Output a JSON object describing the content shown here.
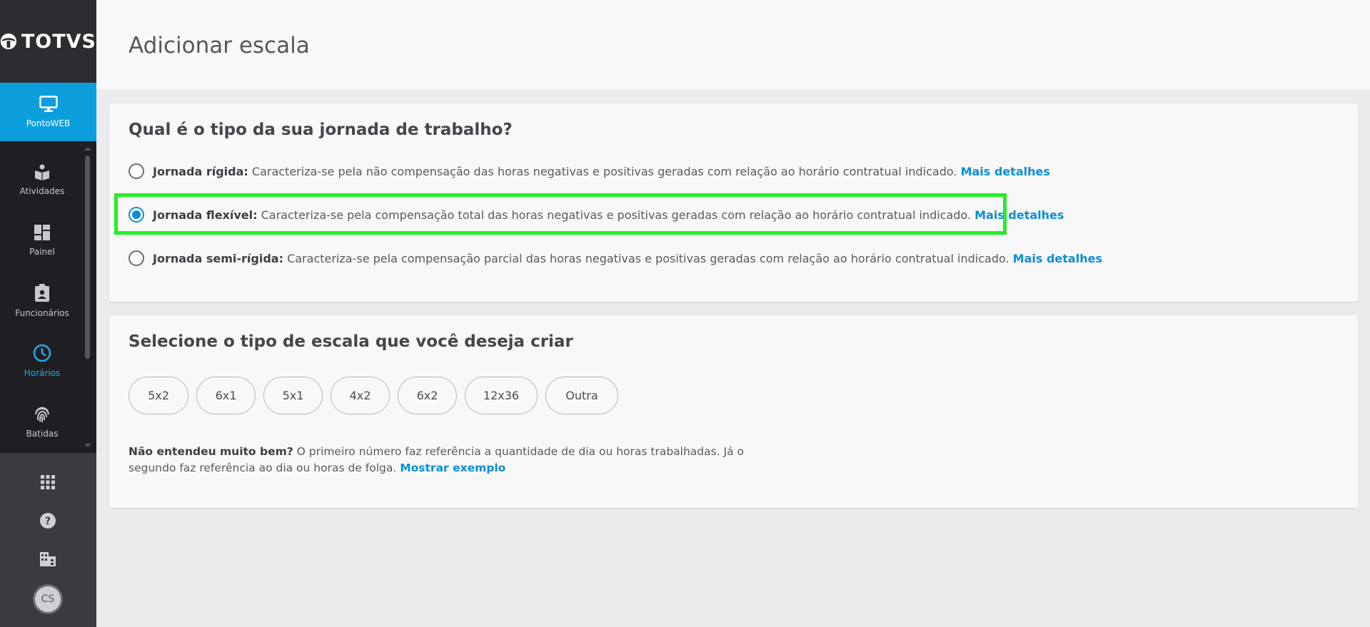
{
  "brand": {
    "logo_text": "TOTVS"
  },
  "sidebar": {
    "active_module": {
      "label": "PontoWEB",
      "icon": "monitor-icon"
    },
    "items": [
      {
        "label": "Atividades",
        "icon": "book-reader-icon",
        "active": false
      },
      {
        "label": "Painel",
        "icon": "dashboard-icon",
        "active": false
      },
      {
        "label": "Funcionários",
        "icon": "badge-icon",
        "active": false
      },
      {
        "label": "Horários",
        "icon": "clock-icon",
        "active": true
      },
      {
        "label": "Batidas",
        "icon": "fingerprint-icon",
        "active": false
      }
    ],
    "bottom": {
      "apps_icon": "apps-grid-icon",
      "help_icon": "help-icon",
      "company_icon": "building-icon",
      "avatar_initials": "CS"
    }
  },
  "header": {
    "title": "Adicionar escala"
  },
  "journey": {
    "question": "Qual é o tipo da sua jornada de trabalho?",
    "options": [
      {
        "name": "Jornada rígida:",
        "description": "Caracteriza-se pela não compensação das horas negativas e positivas geradas com relação ao horário contratual indicado.",
        "link": "Mais detalhes",
        "checked": false
      },
      {
        "name": "Jornada flexível:",
        "description": "Caracteriza-se pela compensação total das horas negativas e positivas geradas com relação ao horário contratual indicado.",
        "link": "Mais detalhes",
        "checked": true
      },
      {
        "name": "Jornada semi-rígida:",
        "description": "Caracteriza-se pela compensação parcial das horas negativas e positivas geradas com relação ao horário contratual indicado.",
        "link": "Mais detalhes",
        "checked": false
      }
    ]
  },
  "scale": {
    "title": "Selecione o tipo de escala que você deseja criar",
    "options": [
      "5x2",
      "6x1",
      "5x1",
      "4x2",
      "6x2",
      "12x36",
      "Outra"
    ],
    "help_bold": "Não entendeu muito bem?",
    "help_text": "O primeiro número faz referência a quantidade de dia ou horas trabalhadas. Já o segundo faz referência ao dia ou horas de folga.",
    "help_link": "Mostrar exemplo"
  },
  "colors": {
    "accent": "#0c9ddc",
    "link": "#0c8ed6",
    "highlight": "#22ef22",
    "sidebar": "#2c2c31"
  }
}
